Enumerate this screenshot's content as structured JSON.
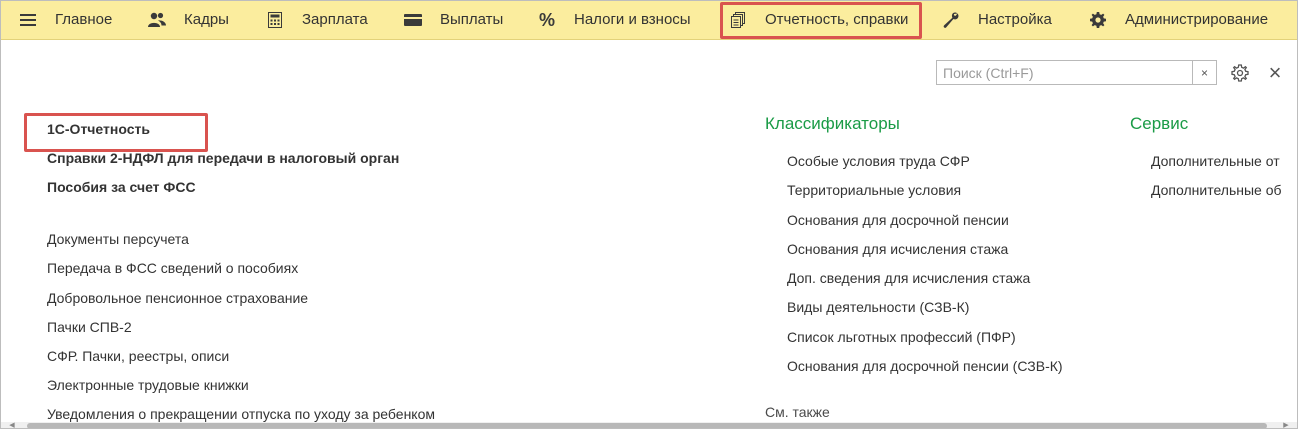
{
  "menu": {
    "items": [
      {
        "label": "Главное",
        "icon": "hamburger-icon"
      },
      {
        "label": "Кадры",
        "icon": "people-icon"
      },
      {
        "label": "Зарплата",
        "icon": "calculator-icon"
      },
      {
        "label": "Выплаты",
        "icon": "wallet-icon"
      },
      {
        "label": "Налоги и взносы",
        "icon": "percent-icon"
      },
      {
        "label": "Отчетность, справки",
        "icon": "documents-icon"
      },
      {
        "label": "Настройка",
        "icon": "wrench-icon"
      },
      {
        "label": "Администрирование",
        "icon": "gear-icon"
      }
    ]
  },
  "toolbar": {
    "search_placeholder": "Поиск (Ctrl+F)",
    "clear_glyph": "×",
    "close_glyph": "×"
  },
  "left": {
    "bold_links": [
      "1С-Отчетность",
      "Справки 2-НДФЛ для передачи в налоговый орган",
      "Пособия за счет ФСС"
    ],
    "links": [
      "Документы персучета",
      "Передача в ФСС сведений о пособиях",
      "Добровольное пенсионное страхование",
      "Пачки СПВ-2",
      "СФР. Пачки, реестры, описи",
      "Электронные трудовые книжки",
      "Уведомления о прекращении отпуска по уходу за ребенком"
    ]
  },
  "classifiers": {
    "title": "Классификаторы",
    "links": [
      "Особые условия труда СФР",
      "Территориальные условия",
      "Основания для досрочной пенсии",
      "Основания для исчисления стажа",
      "Доп. сведения для исчисления стажа",
      "Виды деятельности (СЗВ-К)",
      "Список льготных профессий (ПФР)",
      "Основания для досрочной пенсии (СЗВ-К)"
    ],
    "see_also": "См. также"
  },
  "service": {
    "title": "Сервис",
    "links": [
      "Дополнительные от",
      "Дополнительные об"
    ]
  }
}
